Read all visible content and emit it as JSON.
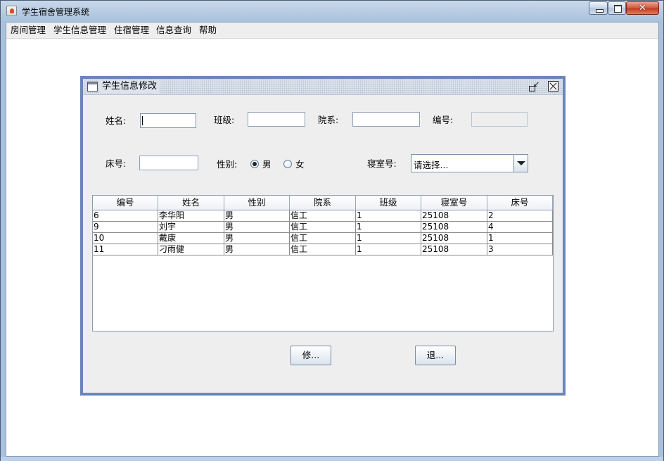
{
  "window": {
    "title": "学生宿舍管理系统"
  },
  "menubar": {
    "items": [
      {
        "label": "房间管理"
      },
      {
        "label": "学生信息管理"
      },
      {
        "label": "住宿管理"
      },
      {
        "label": "信息查询"
      },
      {
        "label": "帮助"
      }
    ]
  },
  "dialog": {
    "title": "学生信息修改",
    "form": {
      "name_label": "姓名:",
      "name_value": "",
      "class_label": "班级:",
      "class_value": "",
      "department_label": "院系:",
      "department_value": "",
      "id_label": "编号:",
      "id_value": "",
      "bed_label": "床号:",
      "bed_value": "",
      "gender_label": "性别:",
      "gender_options": [
        "男",
        "女"
      ],
      "gender_selected": "男",
      "room_label": "寝室号:",
      "room_selected": "请选择..."
    },
    "table": {
      "columns": [
        "编号",
        "姓名",
        "性别",
        "院系",
        "班级",
        "寝室号",
        "床号"
      ],
      "rows": [
        [
          "6",
          "李华阳",
          "男",
          "信工",
          "1",
          "25108",
          "2"
        ],
        [
          "9",
          "刘宇",
          "男",
          "信工",
          "1",
          "25108",
          "4"
        ],
        [
          "10",
          "戴康",
          "男",
          "信工",
          "1",
          "25108",
          "1"
        ],
        [
          "11",
          "刁雨健",
          "男",
          "信工",
          "1",
          "25108",
          "3"
        ]
      ]
    },
    "buttons": {
      "modify_label": "修...",
      "exit_label": "退..."
    }
  }
}
